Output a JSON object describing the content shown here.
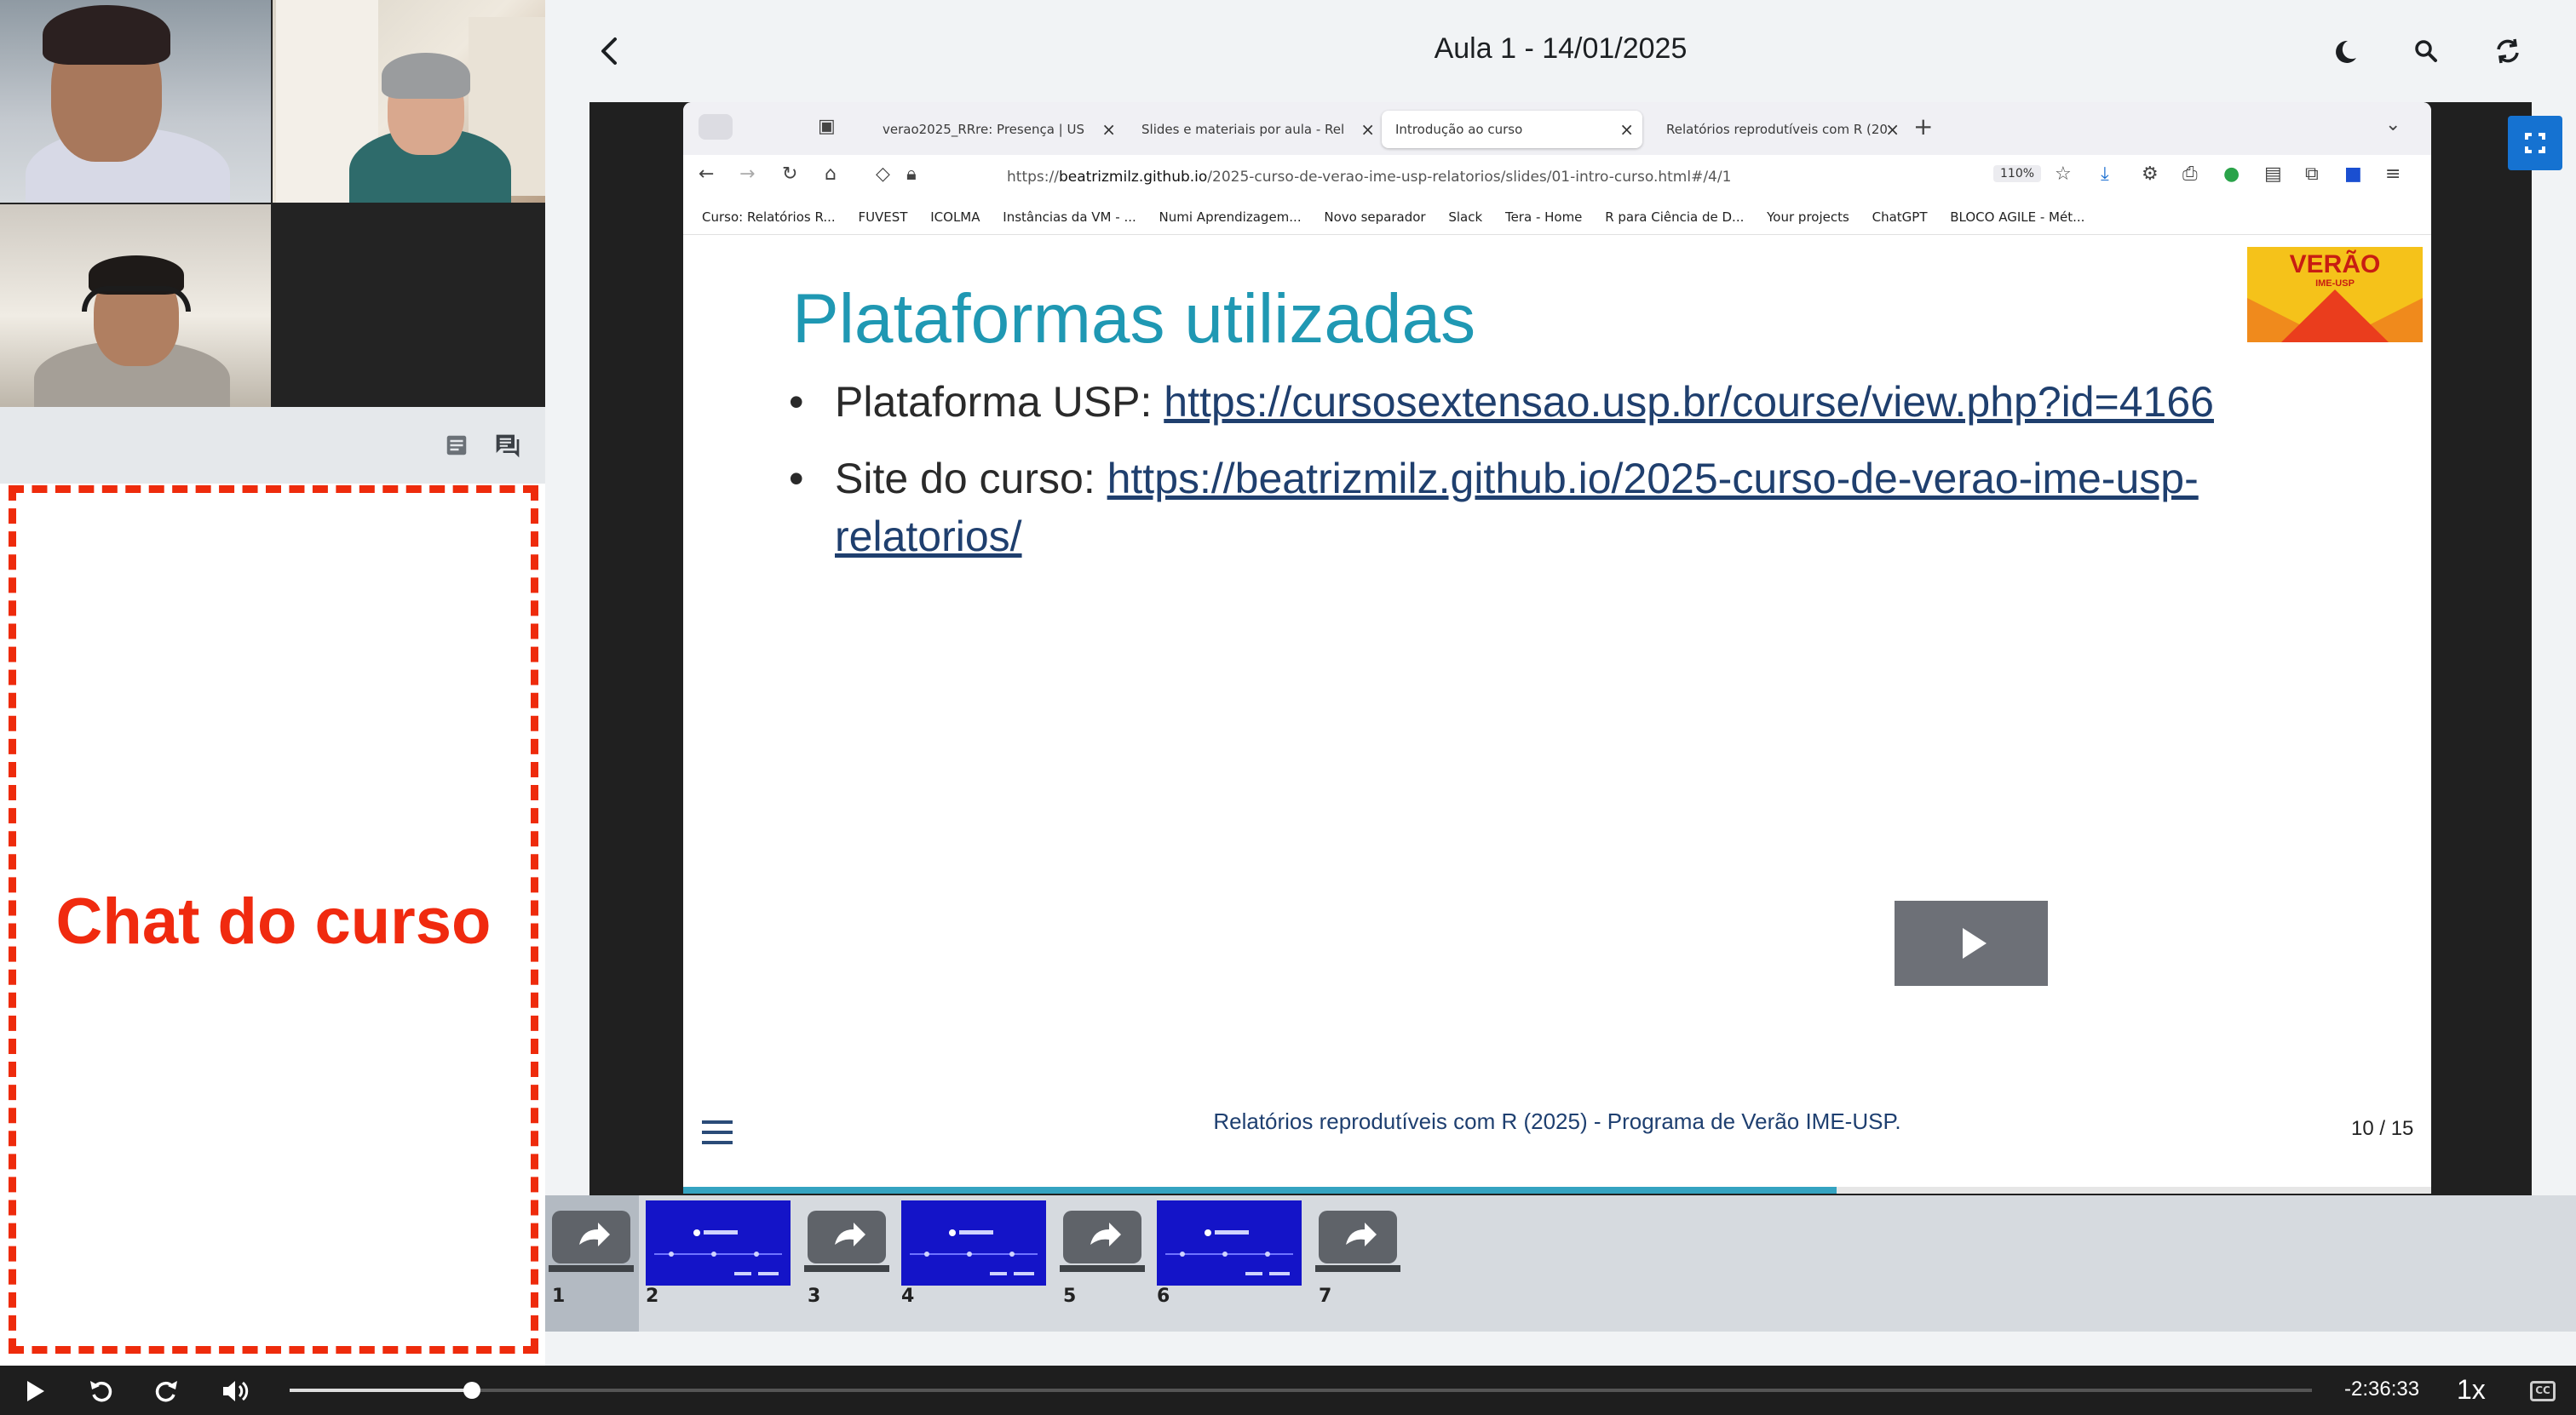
{
  "header": {
    "title": "Aula 1 - 14/01/2025"
  },
  "chat": {
    "label": "Chat do curso"
  },
  "browser": {
    "tabs": [
      {
        "label": "verao2025_RRre: Presença | US"
      },
      {
        "label": "Slides e materiais por aula - Rel"
      },
      {
        "label": "Introdução ao curso"
      },
      {
        "label": "Relatórios reprodutíveis com R (20"
      }
    ],
    "url_prefix": "https://",
    "url_host": "beatrizmilz.github.io",
    "url_path": "/2025-curso-de-verao-ime-usp-relatorios/slides/01-intro-curso.html#/4/1",
    "zoom": "110%",
    "bookmarks": [
      "Curso: Relatórios R...",
      "FUVEST",
      "ICOLMA",
      "Instâncias da VM - ...",
      "Numi Aprendizagem...",
      "Novo separador",
      "Slack",
      "Tera - Home",
      "R para Ciência de D...",
      "Your projects",
      "ChatGPT",
      "BLOCO AGILE - Mét..."
    ]
  },
  "slide": {
    "title": "Plataformas utilizadas",
    "bullet1_label": "Plataforma USP: ",
    "bullet1_link": "https://cursosextensao.usp.br/course/view.php?id=4166",
    "bullet2_label": "Site do curso: ",
    "bullet2_link_line1": "https://beatrizmilz.github.io/2025-curso-de-verao-ime-usp-",
    "bullet2_link_line2": "relatorios/",
    "footer": "Relatórios reprodutíveis com R (2025) - Programa de Verão IME-USP.",
    "page": "10 / 15",
    "progress": 0.66,
    "logo_text": "VERÃO",
    "logo_subtext": "IME-USP"
  },
  "thumbnails": [
    {
      "num": "1",
      "kind": "share"
    },
    {
      "num": "2",
      "kind": "slide"
    },
    {
      "num": "3",
      "kind": "share"
    },
    {
      "num": "4",
      "kind": "slide"
    },
    {
      "num": "5",
      "kind": "share"
    },
    {
      "num": "6",
      "kind": "slide"
    },
    {
      "num": "7",
      "kind": "share"
    }
  ],
  "player": {
    "time_remaining": "-2:36:33",
    "speed": "1x",
    "cc": "CC",
    "progress": 0.09
  },
  "colors": {
    "chat_border": "#ee2b0c",
    "slide_title": "#1f98b3",
    "link": "#1f3f6e",
    "fullscreen_bg": "#1572d1"
  }
}
